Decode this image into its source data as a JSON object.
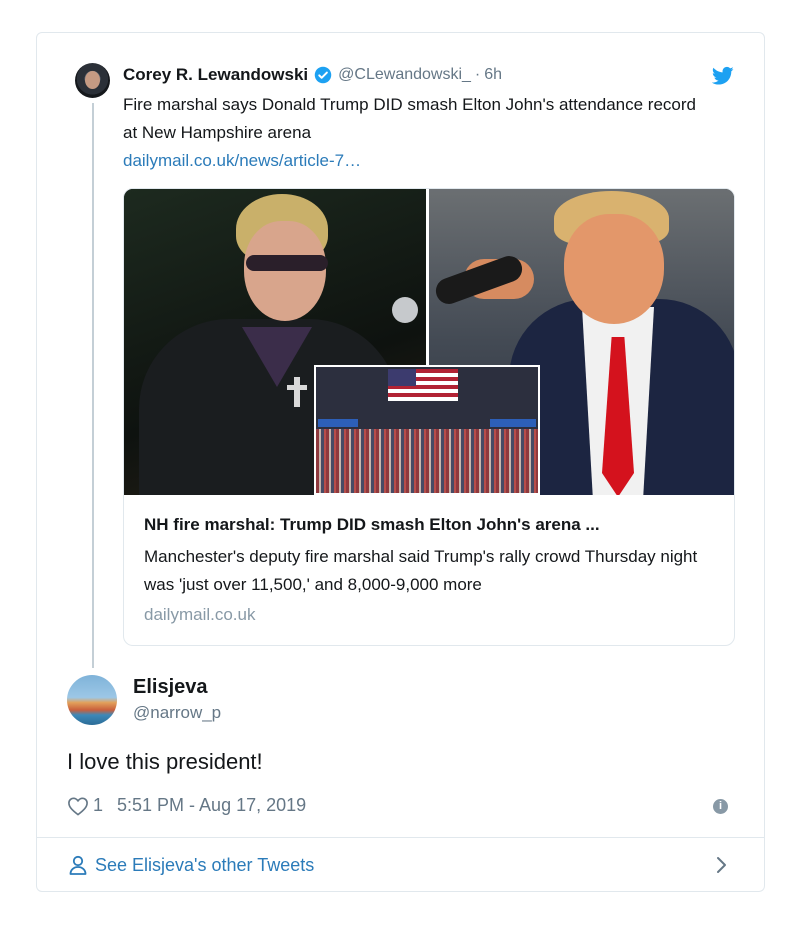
{
  "parent_tweet": {
    "author_name": "Corey R. Lewandowski",
    "handle": "@CLewandowski_",
    "separator": "·",
    "time": "6h",
    "text": "Fire marshal says Donald Trump DID smash Elton John's attendance record at New Hampshire arena",
    "link_text": "dailymail.co.uk/news/article-7…",
    "verified": true
  },
  "link_card": {
    "title": "NH fire marshal: Trump DID smash Elton John's arena ...",
    "description": "Manchester's deputy fire marshal said Trump's rally crowd Thursday night was 'just over 11,500,' and 8,000-9,000 more",
    "domain": "dailymail.co.uk"
  },
  "reply": {
    "author_name": "Elisjeva",
    "handle": "@narrow_p",
    "text": "I love this president!",
    "likes": "1",
    "timestamp": "5:51 PM - Aug 17, 2019"
  },
  "footer": {
    "label": "See Elisjeva's other Tweets"
  },
  "colors": {
    "link": "#2b7bb9",
    "verified": "#1da1f2",
    "twitter_brand": "#1da1f2",
    "muted": "#657786"
  },
  "icons": [
    "twitter-bird-icon",
    "verified-badge-icon",
    "heart-icon",
    "info-icon",
    "person-icon",
    "chevron-right-icon"
  ]
}
